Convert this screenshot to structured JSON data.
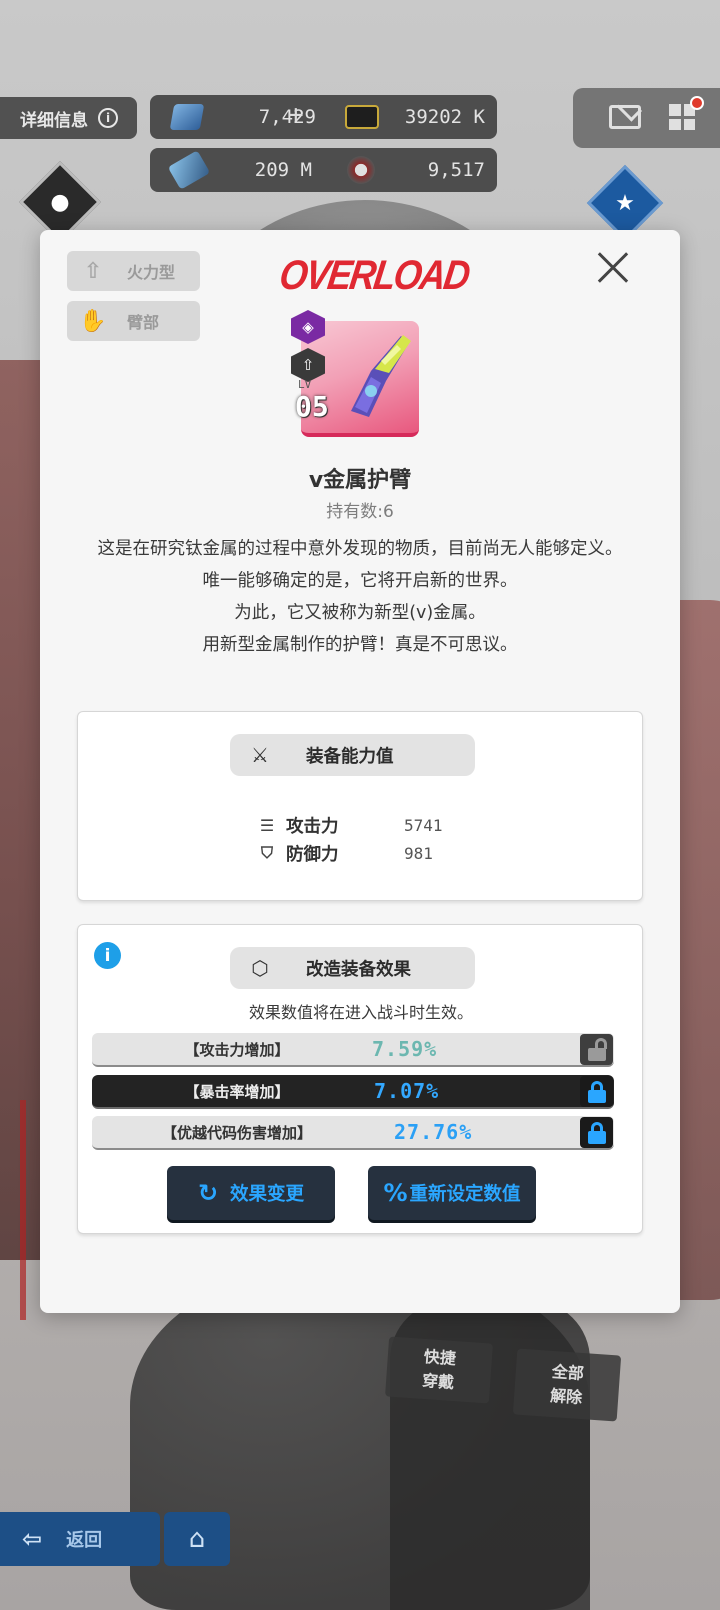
{
  "hud": {
    "detail_label": "详细信息",
    "detail_info_glyph": "i",
    "resources": [
      {
        "name": "gem-icon",
        "value": "7,429",
        "has_plus": true,
        "plus": "+"
      },
      {
        "name": "credit-icon",
        "value": "39202 K"
      },
      {
        "name": "core-dust-icon",
        "value": "209 M"
      },
      {
        "name": "token-icon",
        "value": "9,517"
      }
    ]
  },
  "modal": {
    "tags": [
      {
        "icon": "firepower-icon",
        "label": "火力型"
      },
      {
        "icon": "arm-icon",
        "label": "臂部"
      }
    ],
    "logo": "OVERLOAD",
    "item": {
      "level_label": "LV",
      "level_value": "05",
      "name": "v金属护臂",
      "count_text": "持有数:6",
      "description": [
        "这是在研究钛金属的过程中意外发现的物质，目前尚无人能够定义。",
        "唯一能够确定的是，它将开启新的世界。",
        "为此，它又被称为新型(v)金属。",
        "用新型金属制作的护臂！真是不可思议。"
      ]
    },
    "stats_section": {
      "title": "装备能力值",
      "stats": [
        {
          "icon": "attack-icon",
          "label": "攻击力",
          "value": "5741"
        },
        {
          "icon": "defense-icon",
          "label": "防御力",
          "value": "981"
        }
      ]
    },
    "effects_section": {
      "info_glyph": "i",
      "title": "改造装备效果",
      "note": "效果数值将在进入战斗时生效。",
      "effects": [
        {
          "label": "【攻击力增加】",
          "value": "7.59%",
          "locked": false,
          "value_color": "#6cb7b0"
        },
        {
          "label": "【暴击率增加】",
          "value": "7.07%",
          "locked": true,
          "value_color": "#33a8ff"
        },
        {
          "label": "【优越代码伤害增加】",
          "value": "27.76%",
          "locked": true,
          "value_color": "#2ba0f5"
        }
      ],
      "buttons": {
        "change_label": "效果变更",
        "reset_label": "重新设定数值",
        "reset_glyph": "%"
      }
    }
  },
  "footer": {
    "quick_equip": [
      "快捷",
      "穿戴"
    ],
    "unequip_all": [
      "全部",
      "解除"
    ],
    "back_label": "返回"
  },
  "colors": {
    "accent_blue": "#2aa6ff",
    "logo_red": "#e02832",
    "rarity_pink": "#e8587e",
    "button_bg": "#26313f"
  }
}
